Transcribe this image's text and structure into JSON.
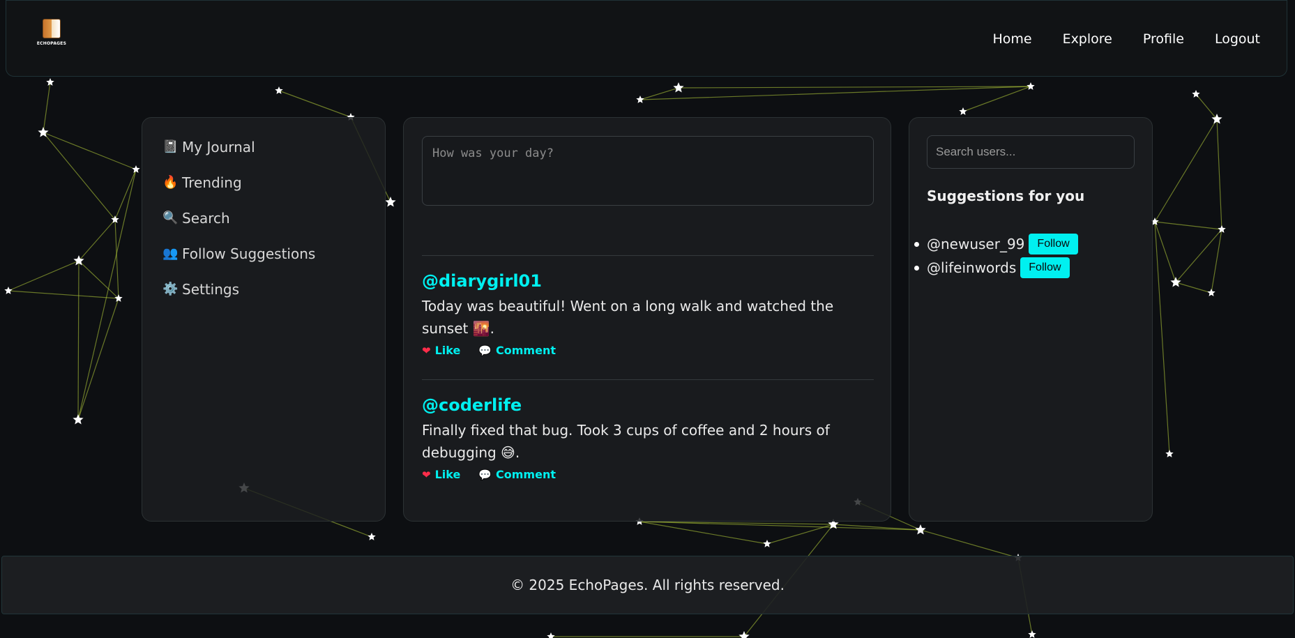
{
  "brand": {
    "logo_text": "ECHOPAGES",
    "logo_icon": "book-icon"
  },
  "nav": {
    "items": [
      {
        "label": "Home"
      },
      {
        "label": "Explore"
      },
      {
        "label": "Profile"
      },
      {
        "label": "Logout"
      }
    ]
  },
  "sidebar": {
    "items": [
      {
        "icon": "📓",
        "icon_name": "journal-icon",
        "label": "My Journal"
      },
      {
        "icon": "🔥",
        "icon_name": "fire-icon",
        "label": "Trending"
      },
      {
        "icon": "🔍",
        "icon_name": "search-icon",
        "label": "Search"
      },
      {
        "icon": "👥",
        "icon_name": "people-icon",
        "label": "Follow Suggestions"
      },
      {
        "icon": "⚙️",
        "icon_name": "gear-icon",
        "label": "Settings"
      }
    ]
  },
  "composer": {
    "placeholder": "How was your day?",
    "value": ""
  },
  "posts": [
    {
      "user": "@diarygirl01",
      "text": "Today was beautiful! Went on a long walk and watched the sunset 🌇.",
      "like_label": "Like",
      "comment_label": "Comment"
    },
    {
      "user": "@coderlife",
      "text": "Finally fixed that bug. Took 3 cups of coffee and 2 hours of debugging 😅.",
      "like_label": "Like",
      "comment_label": "Comment"
    }
  ],
  "right": {
    "search_placeholder": "Search users...",
    "suggestions_title": "Suggestions for you",
    "suggestions": [
      {
        "user": "@newuser_99",
        "button": "Follow"
      },
      {
        "user": "@lifeinwords",
        "button": "Follow"
      }
    ]
  },
  "footer": {
    "text": "© 2025 EchoPages. All rights reserved."
  },
  "colors": {
    "accent": "#00f0f0",
    "background": "#0d0f12",
    "panel": "#1c1e21",
    "network_line": "#b8d23a",
    "heart": "#ff2d4a"
  }
}
